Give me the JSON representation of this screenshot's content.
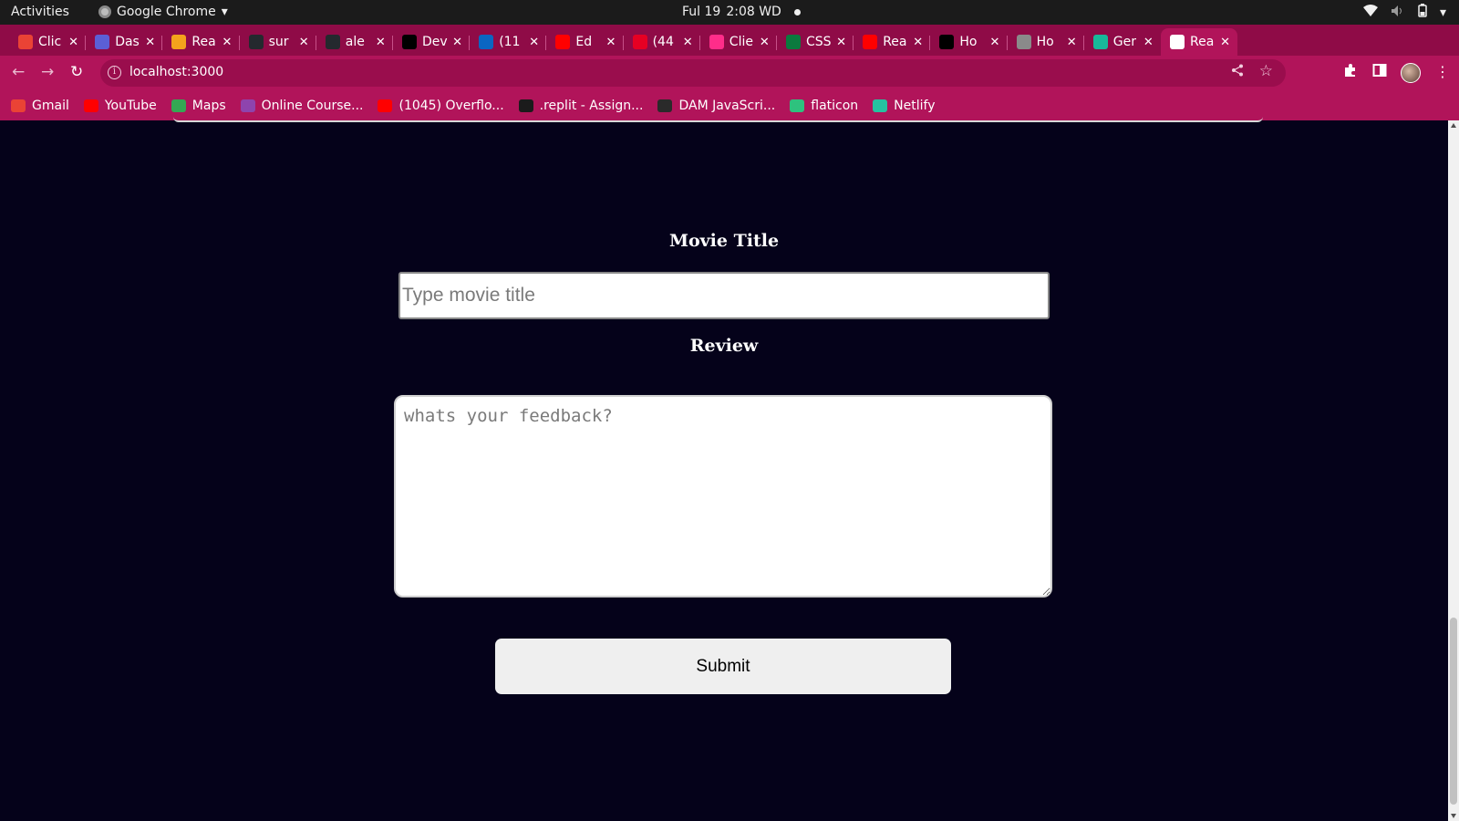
{
  "system_bar": {
    "activities": "Activities",
    "app_name": "Google Chrome",
    "date": "Ful 19",
    "time": "2:08 WD"
  },
  "tabs": [
    {
      "label": "Clic",
      "favicon_color": "#ea4335"
    },
    {
      "label": "Das",
      "favicon_color": "#5b5fd6"
    },
    {
      "label": "Rea",
      "favicon_color": "#f4a31c"
    },
    {
      "label": "sur",
      "favicon_color": "#24292e"
    },
    {
      "label": "ale",
      "favicon_color": "#24292e"
    },
    {
      "label": "Dev",
      "favicon_color": "#000000"
    },
    {
      "label": "(11",
      "favicon_color": "#0a66c2"
    },
    {
      "label": "Ed",
      "favicon_color": "#ff0000"
    },
    {
      "label": "(44",
      "favicon_color": "#e60023"
    },
    {
      "label": "Clie",
      "favicon_color": "#ff2d8a"
    },
    {
      "label": "CSS",
      "favicon_color": "#0b7a3e"
    },
    {
      "label": "Rea",
      "favicon_color": "#ff0000"
    },
    {
      "label": "Ho",
      "favicon_color": "#000000"
    },
    {
      "label": "Ho",
      "favicon_color": "#8a8a8a"
    },
    {
      "label": "Ger",
      "favicon_color": "#18b89a"
    },
    {
      "label": "Rea",
      "favicon_color": "#ffffff"
    }
  ],
  "omnibox": {
    "url": "localhost:3000"
  },
  "bookmarks": [
    {
      "label": "Gmail",
      "icon_color": "#ea4335"
    },
    {
      "label": "YouTube",
      "icon_color": "#ff0000"
    },
    {
      "label": "Maps",
      "icon_color": "#34a853"
    },
    {
      "label": "Online Course...",
      "icon_color": "#8e44ad"
    },
    {
      "label": "(1045) Overflo...",
      "icon_color": "#ff0000"
    },
    {
      "label": ".replit - Assign...",
      "icon_color": "#1b1b1b"
    },
    {
      "label": "DAM JavaScri...",
      "icon_color": "#2a2a2a"
    },
    {
      "label": "flaticon",
      "icon_color": "#2ec27e"
    },
    {
      "label": "Netlify",
      "icon_color": "#25c2a0"
    }
  ],
  "form": {
    "title_label": "Movie Title",
    "title_placeholder": "Type movie title",
    "review_label": "Review",
    "review_placeholder": "whats your feedback?",
    "submit_label": "Submit"
  },
  "colors": {
    "page_bg": "#05021a",
    "chrome_accent": "#b1145a",
    "tabstrip_bg": "#8f0b47"
  }
}
